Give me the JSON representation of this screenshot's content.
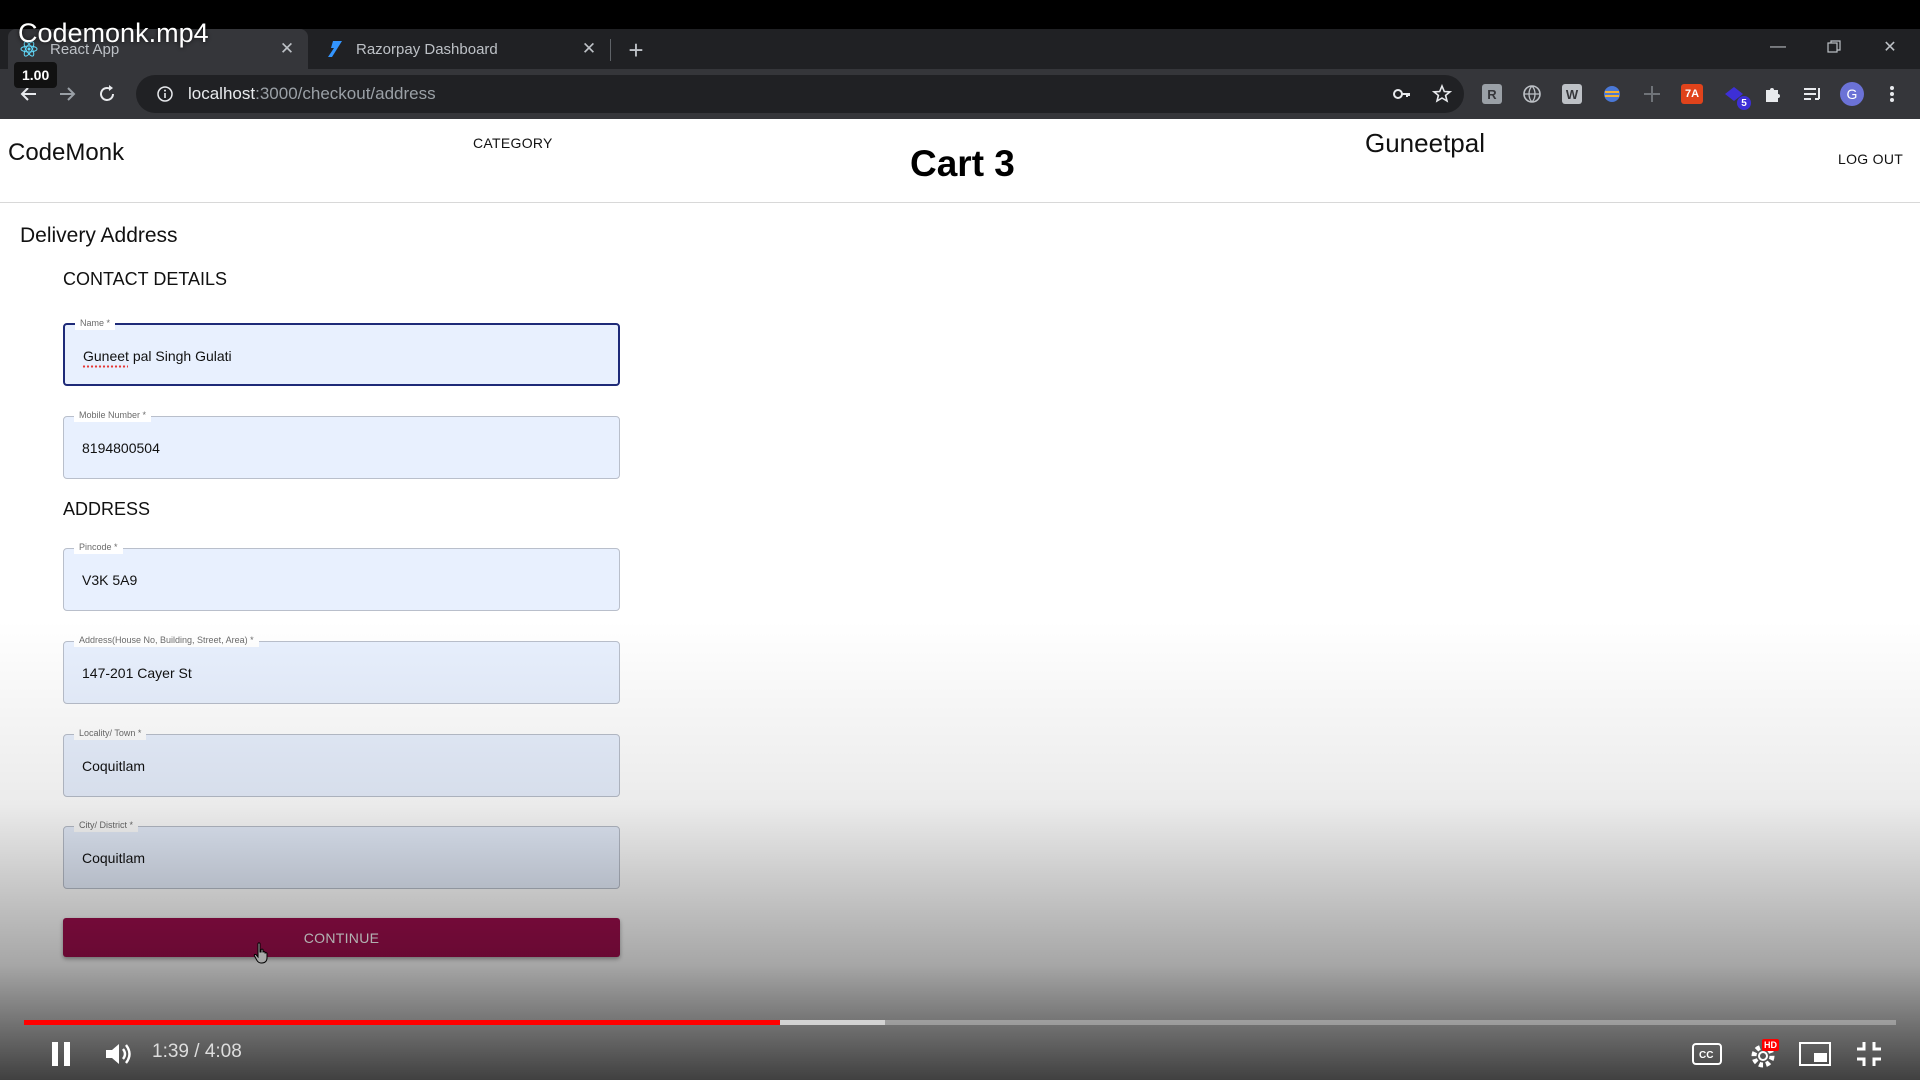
{
  "video": {
    "title": "Codemonk.mp4",
    "speed": "1.00",
    "time_current": "1:39",
    "time_sep": " / ",
    "time_total": "4:08",
    "progress_played": 0.404,
    "progress_buffered": 0.46
  },
  "browser": {
    "tabs": [
      {
        "title": "React App",
        "icon": "react-icon",
        "active": true
      },
      {
        "title": "Razorpay Dashboard",
        "icon": "razorpay-icon",
        "active": false
      }
    ],
    "url_host": "localhost",
    "url_path": ":3000/checkout/address",
    "profile_initial": "G",
    "extension_badge": "5"
  },
  "app": {
    "brand": "CodeMonk",
    "category_label": "CATEGORY",
    "cart_label": "Cart 3",
    "user_name": "Guneetpal",
    "logout_label": "LOG OUT"
  },
  "form": {
    "heading": "Delivery Address",
    "contact_heading": "CONTACT DETAILS",
    "address_heading": "ADDRESS",
    "fields": {
      "name": {
        "label": "Name *",
        "value": "Guneet pal Singh Gulati"
      },
      "mobile": {
        "label": "Mobile Number *",
        "value": "8194800504"
      },
      "pincode": {
        "label": "Pincode *",
        "value": "V3K 5A9"
      },
      "address": {
        "label": "Address(House No, Building, Street, Area) *",
        "value": "147-201 Cayer St"
      },
      "locality": {
        "label": "Locality/ Town *",
        "value": "Coquitlam"
      },
      "city": {
        "label": "City/ District *",
        "value": "Coquitlam"
      }
    },
    "continue_label": "CONTINUE"
  },
  "colors": {
    "accent": "#9e0e4d",
    "progress": "#ff0000",
    "field_bg": "#e8f0fe",
    "focus_border": "#1e2a78"
  }
}
